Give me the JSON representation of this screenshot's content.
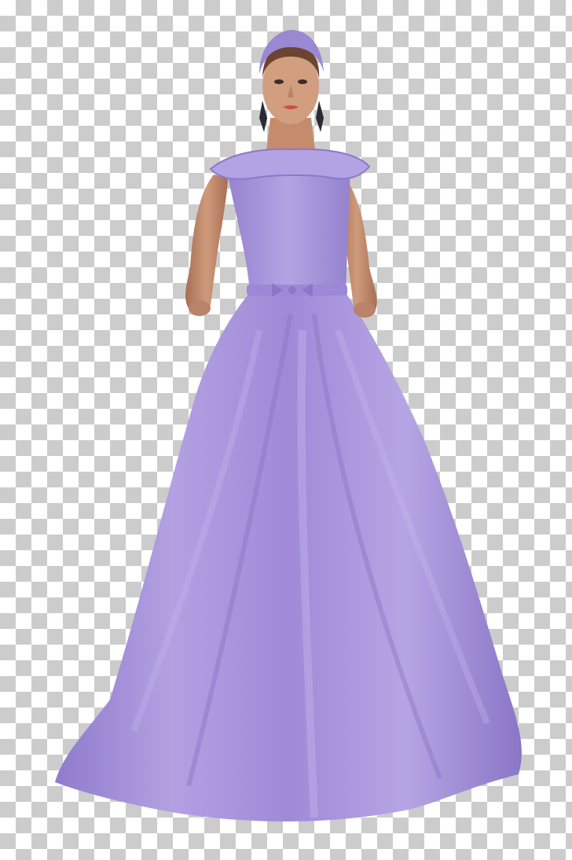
{
  "image": {
    "background": "transparency-checkerboard",
    "colors": {
      "checker_light": "#ffffff",
      "checker_dark": "#cccccc",
      "gown": "#a996d8",
      "gown_shadow": "#7e69bd",
      "gown_highlight": "#c9bbec",
      "skin": "#c99272",
      "skin_shadow": "#a06a50",
      "headband": "#9a88d2",
      "hair": "#5a3a28",
      "earring": "#2a2a32",
      "lips": "#c9504f"
    }
  }
}
